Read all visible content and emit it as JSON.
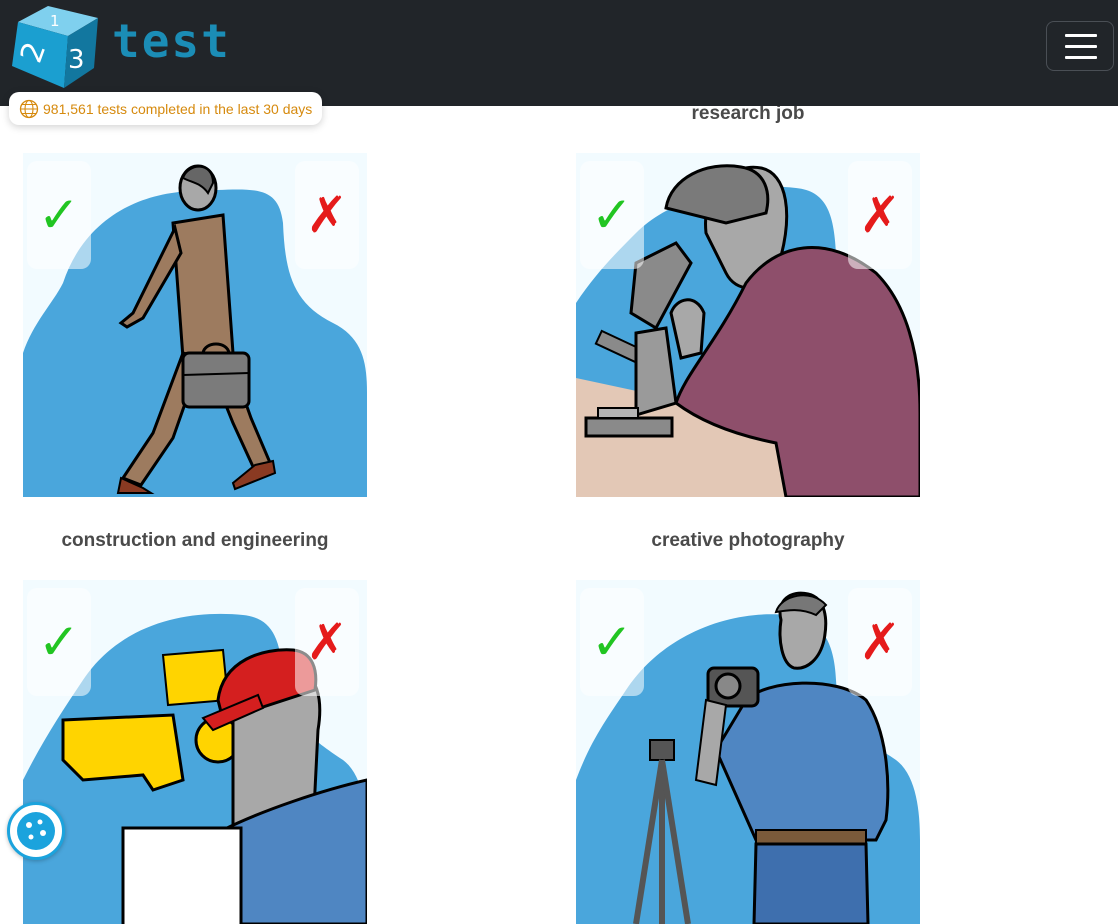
{
  "brand": {
    "logo_text": "test",
    "dice_faces": [
      "1",
      "2",
      "3"
    ]
  },
  "counter": {
    "text": "981,561 tests completed in the last 30 days"
  },
  "colors": {
    "navbar": "#212529",
    "brand_blue": "#1b8db6",
    "counter_orange": "#d68a0e",
    "yes_green": "#22c522",
    "no_red": "#e51b1b"
  },
  "icons": {
    "menu": "hamburger-icon",
    "counter": "globe-icon",
    "like": "checkmark-icon",
    "dislike": "cross-icon",
    "cookie": "cookie-icon"
  },
  "vote": {
    "yes_symbol": "✓",
    "no_symbol": "✗"
  },
  "cards": [
    {
      "title": "",
      "illustration": "businessman walking with briefcase"
    },
    {
      "title": "research job",
      "illustration": "scientist using microscope"
    },
    {
      "title": "construction and engineering",
      "illustration": "worker in hard hat with bulldozer"
    },
    {
      "title": "creative photography",
      "illustration": "photographer with camera and tripod"
    }
  ]
}
